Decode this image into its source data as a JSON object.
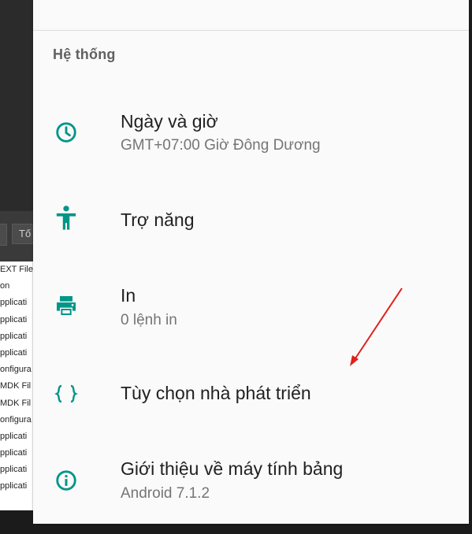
{
  "background_window": {
    "toolbar_text": "Tố",
    "list_items": [
      "EXT File",
      "on",
      "pplicati",
      "pplicati",
      "pplicati",
      "pplicati",
      "onfigura",
      "MDK Fil",
      "MDK Fil",
      "onfigura",
      "pplicati",
      "pplicati",
      "pplicati",
      "pplicati"
    ]
  },
  "settings": {
    "section_title": "Hệ thống",
    "items": [
      {
        "title": "Ngày và giờ",
        "subtitle": "GMT+07:00 Giờ Đông Dương",
        "icon": "clock-icon"
      },
      {
        "title": "Trợ năng",
        "subtitle": "",
        "icon": "accessibility-icon"
      },
      {
        "title": "In",
        "subtitle": "0 lệnh in",
        "icon": "printer-icon"
      },
      {
        "title": "Tùy chọn nhà phát triển",
        "subtitle": "",
        "icon": "developer-braces-icon"
      },
      {
        "title": "Giới thiệu về máy tính bảng",
        "subtitle": "Android 7.1.2",
        "icon": "info-icon"
      }
    ]
  },
  "colors": {
    "accent": "#009688",
    "annotation_arrow": "#e0201c"
  }
}
